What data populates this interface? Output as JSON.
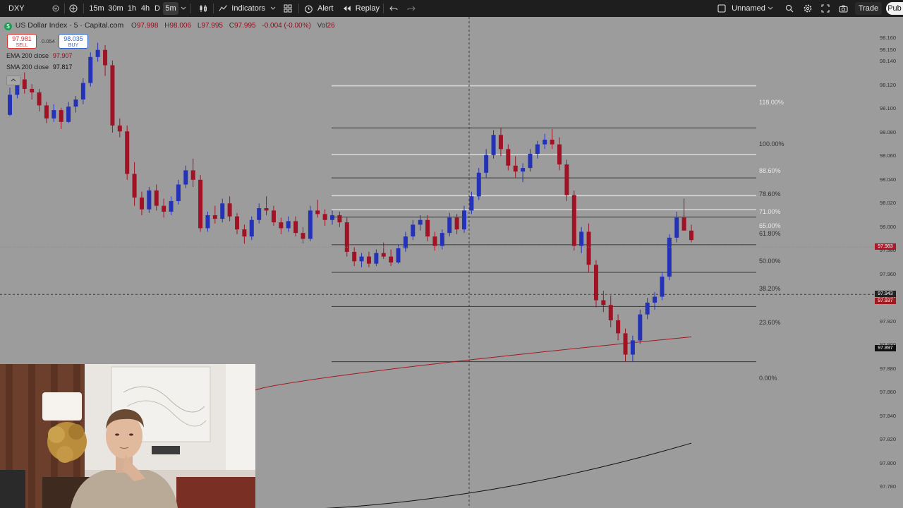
{
  "toolbar": {
    "symbol": "DXY",
    "intervals": [
      "15m",
      "30m",
      "1h",
      "4h",
      "D",
      "5m"
    ],
    "selected_interval": "5m",
    "indicators_label": "Indicators",
    "alert_label": "Alert",
    "replay_label": "Replay",
    "layout_name": "Unnamed",
    "trade_label": "Trade",
    "publish_label": "Pub"
  },
  "legend": {
    "title": "US Dollar Index · 5 · Capital.com",
    "open_label": "O",
    "open": "97.998",
    "high_label": "H",
    "high": "98.006",
    "low_label": "L",
    "low": "97.995",
    "close_label": "C",
    "close": "97.995",
    "change": "-0.004 (-0.00%)",
    "vol_label": "Vol",
    "vol": "26",
    "sell_price": "97.981",
    "sell_label": "SELL",
    "spread": "0.054",
    "buy_price": "98.035",
    "buy_label": "BUY",
    "ema_label": "EMA 200 close",
    "ema_value": "97.907",
    "sma_label": "SMA 200 close",
    "sma_value": "97.817"
  },
  "fib_levels": [
    {
      "level": 1.18,
      "label": "118.00%"
    },
    {
      "level": 1.0,
      "label": "100.00%"
    },
    {
      "level": 0.886,
      "label": "88.60%"
    },
    {
      "level": 0.786,
      "label": "78.60%"
    },
    {
      "level": 0.71,
      "label": "71.00%"
    },
    {
      "level": 0.65,
      "label": "65.00%"
    },
    {
      "level": 0.618,
      "label": "61.80%"
    },
    {
      "level": 0.5,
      "label": "50.00%"
    },
    {
      "level": 0.382,
      "label": "38.20%"
    },
    {
      "level": 0.236,
      "label": "23.60%"
    },
    {
      "level": 0.0,
      "label": "0.00%"
    }
  ],
  "price_axis": {
    "ticks": [
      "98.160",
      "98.150",
      "98.140",
      "98.120",
      "98.100",
      "98.080",
      "98.060",
      "98.040",
      "98.020",
      "98.000",
      "97.980",
      "97.960",
      "97.940",
      "97.920",
      "97.900",
      "97.880",
      "97.860",
      "97.840",
      "97.820",
      "97.800",
      "97.780"
    ],
    "last_price": "97.983",
    "crosshair_price": "97.943",
    "ema_tag": "97.937",
    "sma_tag": "97.897"
  },
  "colors": {
    "up": "#2432b8",
    "down": "#a01325",
    "fib_line": "#3a3a3a",
    "fib_line_light": "#d6d6d6",
    "ema": "#a01a22",
    "sma": "#111111",
    "background": "#9c9c9c"
  },
  "chart_data": {
    "type": "candlestick",
    "symbol": "US Dollar Index",
    "interval": "5",
    "candles": [
      [
        98.095,
        98.118,
        98.094,
        98.112
      ],
      [
        98.112,
        98.128,
        98.109,
        98.125
      ],
      [
        98.125,
        98.131,
        98.113,
        98.117
      ],
      [
        98.117,
        98.121,
        98.108,
        98.114
      ],
      [
        98.114,
        98.117,
        98.098,
        98.103
      ],
      [
        98.103,
        98.106,
        98.088,
        98.092
      ],
      [
        98.092,
        98.104,
        98.089,
        98.099
      ],
      [
        98.099,
        98.101,
        98.083,
        98.089
      ],
      [
        98.089,
        98.106,
        98.088,
        98.102
      ],
      [
        98.102,
        98.111,
        98.097,
        98.108
      ],
      [
        98.108,
        98.126,
        98.104,
        98.122
      ],
      [
        98.122,
        98.148,
        98.119,
        98.144
      ],
      [
        98.144,
        98.156,
        98.14,
        98.15
      ],
      [
        98.15,
        98.154,
        98.128,
        98.137
      ],
      [
        98.137,
        98.141,
        98.08,
        98.086
      ],
      [
        98.086,
        98.092,
        98.076,
        98.081
      ],
      [
        98.081,
        98.086,
        98.04,
        98.045
      ],
      [
        98.045,
        98.055,
        98.018,
        98.025
      ],
      [
        98.025,
        98.03,
        98.01,
        98.015
      ],
      [
        98.015,
        98.034,
        98.012,
        98.031
      ],
      [
        98.031,
        98.036,
        98.014,
        98.018
      ],
      [
        98.018,
        98.024,
        98.008,
        98.013
      ],
      [
        98.013,
        98.026,
        98.01,
        98.022
      ],
      [
        98.022,
        98.04,
        98.019,
        98.036
      ],
      [
        98.036,
        98.052,
        98.033,
        98.048
      ],
      [
        98.048,
        98.058,
        98.034,
        98.04
      ],
      [
        98.04,
        98.044,
        97.996,
        97.999
      ],
      [
        97.999,
        98.013,
        97.996,
        98.01
      ],
      [
        98.01,
        98.018,
        98.003,
        98.007
      ],
      [
        98.007,
        98.024,
        98.004,
        98.02
      ],
      [
        98.02,
        98.026,
        98.005,
        98.009
      ],
      [
        98.009,
        98.012,
        97.994,
        97.998
      ],
      [
        97.998,
        98.002,
        97.986,
        97.992
      ],
      [
        97.992,
        98.009,
        97.989,
        98.006
      ],
      [
        98.006,
        98.02,
        98.003,
        98.016
      ],
      [
        98.016,
        98.026,
        98.01,
        98.014
      ],
      [
        98.014,
        98.018,
        98.001,
        98.004
      ],
      [
        98.004,
        98.008,
        97.994,
        97.999
      ],
      [
        97.999,
        98.009,
        97.996,
        98.005
      ],
      [
        98.005,
        98.009,
        97.992,
        97.995
      ],
      [
        97.995,
        98.0,
        97.986,
        97.99
      ],
      [
        97.99,
        98.018,
        97.988,
        98.014
      ],
      [
        98.014,
        98.023,
        98.008,
        98.011
      ],
      [
        98.011,
        98.015,
        98.001,
        98.006
      ],
      [
        98.006,
        98.014,
        98.002,
        98.01
      ],
      [
        98.01,
        98.013,
        98.0,
        98.004
      ],
      [
        98.004,
        98.008,
        97.975,
        97.979
      ],
      [
        97.979,
        97.983,
        97.967,
        97.971
      ],
      [
        97.971,
        97.978,
        97.966,
        97.975
      ],
      [
        97.975,
        97.979,
        97.966,
        97.969
      ],
      [
        97.969,
        97.981,
        97.967,
        97.978
      ],
      [
        97.978,
        97.987,
        97.973,
        97.975
      ],
      [
        97.975,
        97.981,
        97.967,
        97.97
      ],
      [
        97.97,
        97.985,
        97.969,
        97.982
      ],
      [
        97.982,
        97.996,
        97.979,
        97.992
      ],
      [
        97.992,
        98.006,
        97.989,
        98.002
      ],
      [
        98.002,
        98.01,
        97.997,
        98.006
      ],
      [
        98.006,
        98.01,
        97.988,
        97.992
      ],
      [
        97.992,
        97.996,
        97.98,
        97.984
      ],
      [
        97.984,
        97.998,
        97.981,
        97.995
      ],
      [
        97.995,
        98.012,
        97.992,
        98.008
      ],
      [
        98.008,
        98.011,
        97.994,
        97.998
      ],
      [
        97.998,
        98.018,
        97.995,
        98.014
      ],
      [
        98.014,
        98.03,
        98.011,
        98.026
      ],
      [
        98.026,
        98.05,
        98.023,
        98.046
      ],
      [
        98.046,
        98.066,
        98.042,
        98.061
      ],
      [
        98.061,
        98.082,
        98.058,
        98.078
      ],
      [
        98.078,
        98.084,
        98.06,
        98.066
      ],
      [
        98.066,
        98.07,
        98.048,
        98.052
      ],
      [
        98.052,
        98.06,
        98.042,
        98.047
      ],
      [
        98.047,
        98.054,
        98.038,
        98.05
      ],
      [
        98.05,
        98.066,
        98.047,
        98.062
      ],
      [
        98.062,
        98.073,
        98.058,
        98.07
      ],
      [
        98.07,
        98.079,
        98.066,
        98.074
      ],
      [
        98.074,
        98.083,
        98.066,
        98.07
      ],
      [
        98.07,
        98.076,
        98.048,
        98.053
      ],
      [
        98.053,
        98.057,
        98.022,
        98.027
      ],
      [
        98.027,
        98.031,
        97.98,
        97.984
      ],
      [
        97.984,
        98.0,
        97.978,
        97.996
      ],
      [
        97.996,
        98.003,
        97.962,
        97.968
      ],
      [
        97.968,
        97.972,
        97.932,
        97.938
      ],
      [
        97.938,
        97.946,
        97.928,
        97.934
      ],
      [
        97.934,
        97.942,
        97.915,
        97.921
      ],
      [
        97.921,
        97.926,
        97.904,
        97.91
      ],
      [
        97.91,
        97.914,
        97.886,
        97.892
      ],
      [
        97.892,
        97.908,
        97.886,
        97.904
      ],
      [
        97.904,
        97.93,
        97.901,
        97.926
      ],
      [
        97.926,
        97.94,
        97.922,
        97.936
      ],
      [
        97.936,
        97.945,
        97.93,
        97.941
      ],
      [
        97.941,
        97.962,
        97.938,
        97.958
      ],
      [
        97.958,
        97.994,
        97.955,
        97.991
      ],
      [
        97.991,
        98.013,
        97.987,
        98.008
      ],
      [
        98.008,
        98.024,
        98.004,
        97.997
      ],
      [
        97.997,
        98.002,
        97.987,
        97.989
      ]
    ],
    "ema200": {
      "name": "EMA 200 close",
      "value": 97.907
    },
    "sma200": {
      "name": "SMA 200 close",
      "value": 97.817
    },
    "fib_retracement": {
      "high": 98.084,
      "low": 97.886
    }
  }
}
